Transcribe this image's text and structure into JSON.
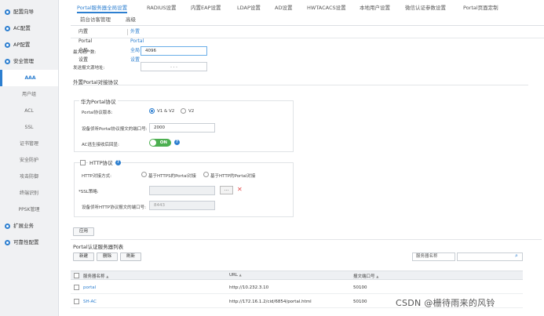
{
  "sidebar": {
    "top_items": [
      {
        "label": "配置向导"
      },
      {
        "label": "AC配置"
      },
      {
        "label": "AP配置"
      },
      {
        "label": "安全管理"
      }
    ],
    "sub_items": [
      {
        "label": "AAA"
      },
      {
        "label": "用户组"
      },
      {
        "label": "ACL"
      },
      {
        "label": "SSL"
      },
      {
        "label": "证书管理"
      },
      {
        "label": "安全防护"
      },
      {
        "label": "攻击防御"
      },
      {
        "label": "终端识别"
      },
      {
        "label": "PPSK管理"
      }
    ],
    "bottom_items": [
      {
        "label": "扩展业务"
      },
      {
        "label": "可靠性配置"
      }
    ]
  },
  "tabs": [
    {
      "label": "Portal服务器全局设置"
    },
    {
      "label": "RADIUS设置"
    },
    {
      "label": "内置EAP设置"
    },
    {
      "label": "LDAP设置"
    },
    {
      "label": "AD设置"
    },
    {
      "label": "HWTACACS设置"
    },
    {
      "label": "本地用户设置"
    },
    {
      "label": "微信认证参数设置"
    },
    {
      "label": "Portal页面定制"
    },
    {
      "label": "前台访客管理"
    },
    {
      "label": "高级"
    }
  ],
  "subtabs": [
    {
      "label": "内置Portal全局设置"
    },
    {
      "label": "外置Portal全局设置"
    }
  ],
  "form": {
    "max_users_label": "最大用户数:",
    "max_users_value": "4096",
    "src_addr_label": "发送报文源地址:",
    "src_addr_value": ".       .       .",
    "protocol_section_title": "外置Portal对接协议",
    "huawei_box_title": "华为Portal协议",
    "portal_version_label": "Portal协议版本:",
    "v1v2_label": "V1 & V2",
    "v2_label": "V2",
    "listen_port_label": "设备侦听Portal协议报文的端口号:",
    "listen_port_value": "2000",
    "ac_escape_label": "AC逃生接收后回显:",
    "toggle_label": "ON",
    "help_glyph": "?",
    "http_box_title": "HTTP协议",
    "http_mode_label": "HTTP对接方式:",
    "https_option": "基于HTTPS的Portal对接",
    "http_option": "基于HTTP的Portal对接",
    "ssl_policy_label": "*SSL策略:",
    "browse_label": "...",
    "x_glyph": "✕",
    "http_port_label": "设备侦听HTTP协议报文的端口号:",
    "http_port_placeholder": "8443",
    "apply_label": "应用"
  },
  "server_list": {
    "title": "Portal认证服务器列表",
    "new_label": "新建",
    "delete_label": "删除",
    "refresh_label": "刷新",
    "filter_select": "服务器名称",
    "search_glyph": "⌕",
    "columns": [
      "服务器名称",
      "URL",
      "报文端口号"
    ],
    "sort_glyph": "▲",
    "rows": [
      {
        "name": "portal",
        "url": "http://10.232.3.10",
        "port": "50100"
      },
      {
        "name": "SH-AC",
        "url": "http://172.16.1.2/cid/6854/portal.html",
        "port": "50100"
      }
    ]
  },
  "watermark": "CSDN @栅待雨来的风铃"
}
